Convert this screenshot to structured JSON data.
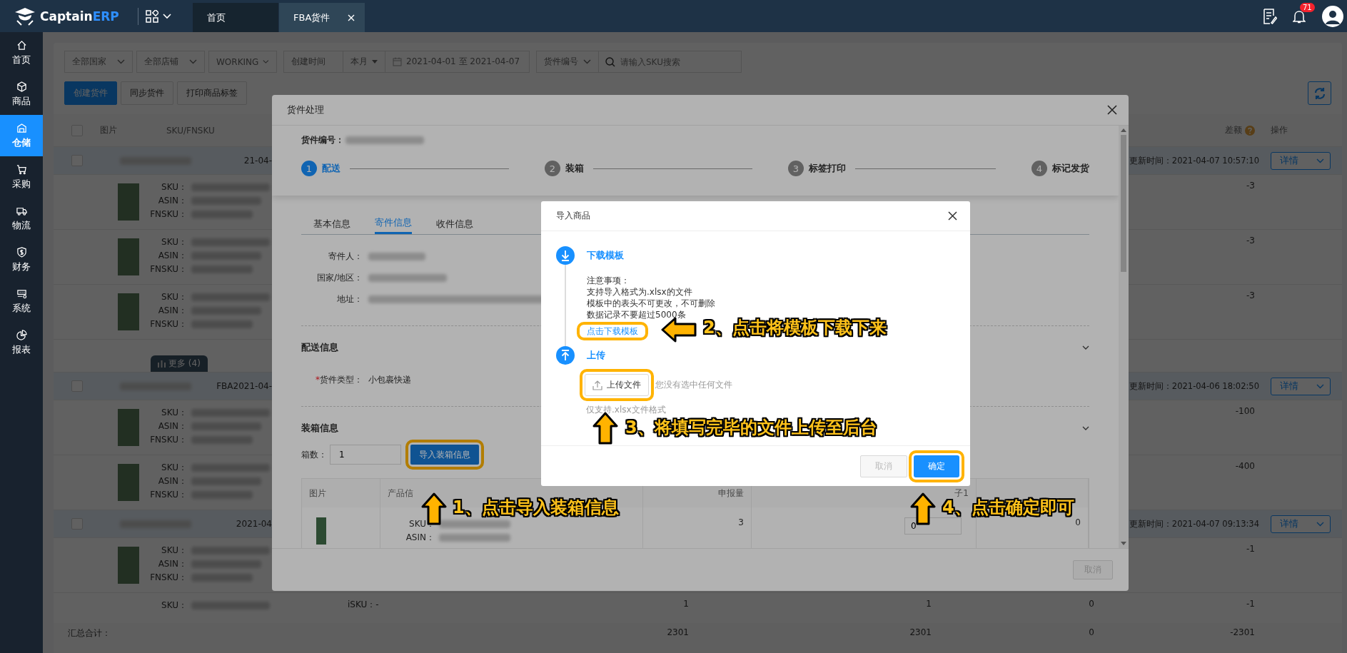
{
  "logo": {
    "text": "Captain",
    "accent": "ERP"
  },
  "tabs": [
    {
      "label": "首页",
      "selected": false,
      "closable": false
    },
    {
      "label": "FBA货件",
      "selected": true,
      "closable": true
    }
  ],
  "notification_count": "71",
  "sidebar": {
    "items": [
      {
        "label": "首页",
        "selected": false
      },
      {
        "label": "商品",
        "selected": false
      },
      {
        "label": "仓储",
        "selected": true
      },
      {
        "label": "采购",
        "selected": false
      },
      {
        "label": "物流",
        "selected": false
      },
      {
        "label": "财务",
        "selected": false
      },
      {
        "label": "系统",
        "selected": false
      },
      {
        "label": "报表",
        "selected": false
      }
    ]
  },
  "filters": {
    "selects": [
      "全部国家",
      "全部店铺",
      "WORKING"
    ],
    "date_type": "创建时间",
    "date_range": "本月",
    "date_value": "2021-04-01 至 2021-04-07",
    "search_field": "货件编号",
    "search_placeholder": "请输入SKU搜索"
  },
  "actions": [
    {
      "label": "创建货件",
      "kind": "primary"
    },
    {
      "label": "同步货件",
      "kind": "default"
    },
    {
      "label": "打印商品标签",
      "kind": "default"
    }
  ],
  "table": {
    "select_all_checked": false,
    "columns": {
      "image": "图片",
      "sku": "SKU/FNSKU",
      "diff": "差额",
      "action": "操作"
    },
    "groups": [
      {
        "checked": false,
        "shipment_name": "21-04-",
        "updated": "更新时间：2021-04-07 10:57:10",
        "action": "详情",
        "more": "更多 (4)",
        "items": [
          {
            "labels": [
              "SKU：",
              "ASIN：",
              "FNSKU："
            ],
            "diff": "-3"
          },
          {
            "labels": [
              "SKU：",
              "ASIN：",
              "FNSKU："
            ],
            "diff": "-3"
          },
          {
            "labels": [
              "SKU：",
              "ASIN：",
              "FNSKU："
            ],
            "diff": "-3"
          }
        ]
      },
      {
        "checked": false,
        "shipment_name": "FBA2021-04-",
        "updated": "更新时间：2021-04-06 18:02:50",
        "action": "详情",
        "items": [
          {
            "labels": [
              "SKU：",
              "ASIN：",
              "FNSKU："
            ],
            "diff": "-100"
          },
          {
            "labels": [
              "SKU：",
              "ASIN：",
              "FNSKU："
            ],
            "diff": "-400"
          }
        ]
      },
      {
        "checked": false,
        "shipment_name": "2021-04",
        "updated": "更新时间：2021-04-07 09:13:34",
        "action": "详情",
        "items": [
          {
            "labels": [
              "SKU：",
              "ASIN：",
              "FNSKU："
            ],
            "diff": "-1"
          },
          {
            "labels": [
              "SKU："
            ],
            "col_4": "iSKU：-",
            "col_5": "1",
            "col_6": "1",
            "col_7": "0",
            "diff": "-1"
          }
        ]
      }
    ],
    "footer": {
      "label": "汇总合计：",
      "col_5": "2301",
      "col_6": "2301",
      "col_7": "0",
      "diff": "-2301"
    }
  },
  "shipment_dialog": {
    "title": "货件处理",
    "number_label": "货件编号：",
    "steps": [
      {
        "number": "1",
        "label": "配送",
        "selected": true
      },
      {
        "number": "2",
        "label": "装箱",
        "selected": false
      },
      {
        "number": "3",
        "label": "标签打印",
        "selected": false
      },
      {
        "number": "4",
        "label": "标记发货",
        "selected": false
      }
    ],
    "tabs": [
      {
        "label": "基本信息",
        "selected": false
      },
      {
        "label": "寄件信息",
        "selected": true
      },
      {
        "label": "收件信息",
        "selected": false
      }
    ],
    "sender_fields": [
      "寄件人：",
      "国家/地区：",
      "地址："
    ],
    "delivery": {
      "title": "配送信息",
      "required_mark": "*",
      "label": "货件类型：",
      "value": "小包裹快递"
    },
    "packing": {
      "title": "装箱信息",
      "count_label": "箱数：",
      "count_value": "1",
      "import_button": "导入装箱信息",
      "columns": [
        "图片",
        "产品信",
        "申报量",
        "子1"
      ],
      "rows": [
        {
          "labels": [
            "SKU：",
            "ASIN："
          ],
          "declared": "3",
          "box_value": "0",
          "col_5": "0"
        }
      ]
    },
    "buttons": [
      {
        "label": "取消",
        "disabled": true
      }
    ]
  },
  "import_dialog": {
    "title": "导入商品",
    "steps": [
      {
        "kind": "download",
        "title": "下载模板"
      },
      {
        "kind": "upload",
        "title": "上传"
      }
    ],
    "notes": [
      "注意事项：",
      "支持导入格式为.xlsx的文件",
      "模板中的表头不可更改，不可删除",
      "数据记录不要超过5000条"
    ],
    "download_link": "点击下载模板",
    "upload_button": "上传文件",
    "no_file_text": "您没有选中任何文件",
    "hint": "仅支持.xlsx文件格式",
    "buttons": [
      {
        "label": "取消",
        "kind": "default",
        "disabled": true
      },
      {
        "label": "确定",
        "kind": "primary",
        "disabled": false
      }
    ]
  },
  "annotations": [
    {
      "text": "2、点击将模板下载下来",
      "kind": "left"
    },
    {
      "text": "3、将填写完毕的文件上传至后台",
      "kind": "up"
    },
    {
      "text": "1、点击导入装箱信息",
      "kind": "up"
    },
    {
      "text": "4、点击确定即可",
      "kind": "up"
    }
  ]
}
